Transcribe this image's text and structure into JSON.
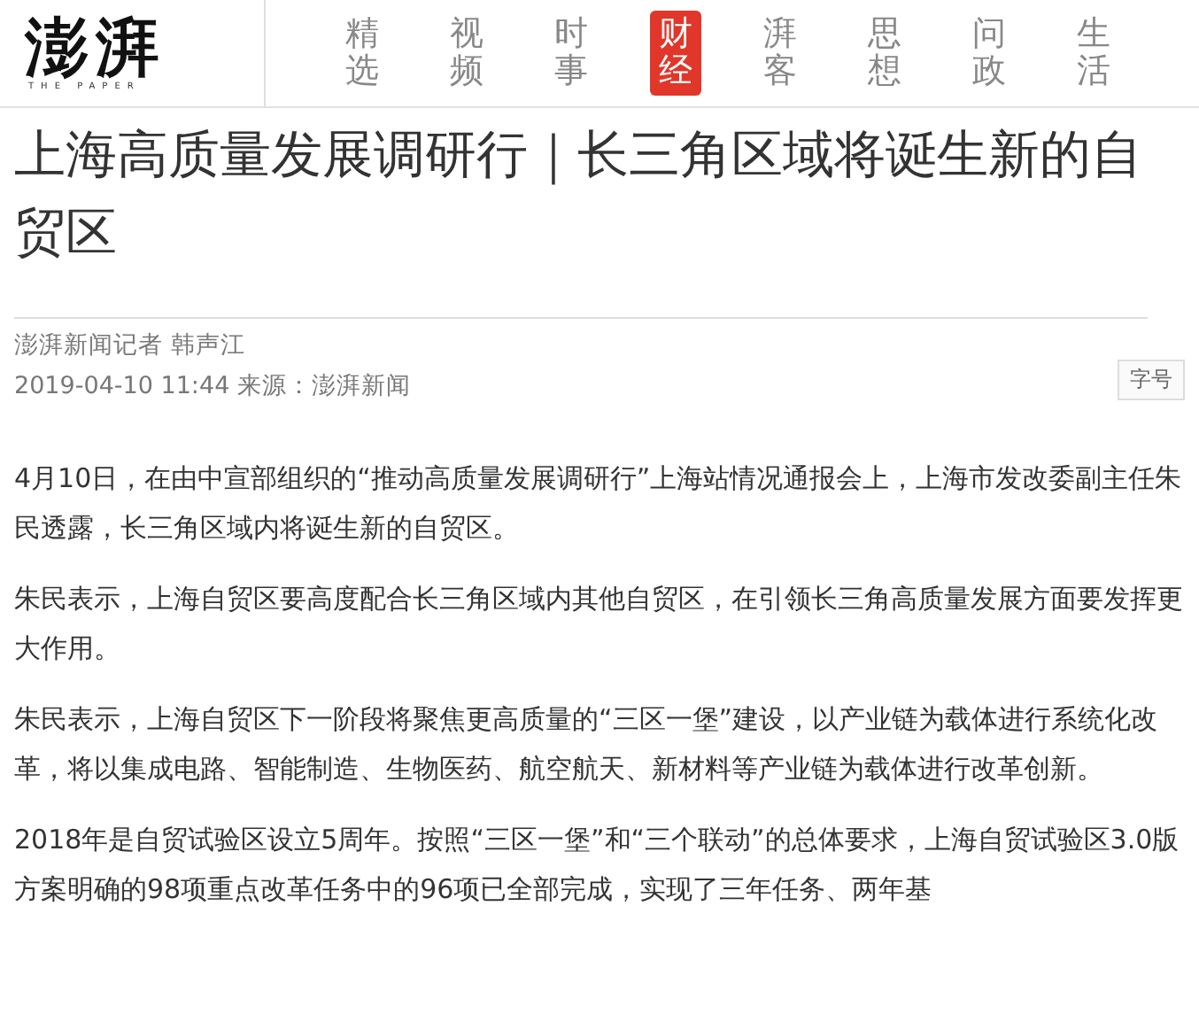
{
  "header": {
    "logo": "澎湃",
    "logo_tagline": "THE PAPER",
    "nav": [
      {
        "label": "精选",
        "selected": false
      },
      {
        "label": "视频",
        "selected": false
      },
      {
        "label": "时事",
        "selected": false
      },
      {
        "label": "财经",
        "selected": true
      },
      {
        "label": "湃客",
        "selected": false
      },
      {
        "label": "思想",
        "selected": false
      },
      {
        "label": "问政",
        "selected": false
      },
      {
        "label": "生活",
        "selected": false
      }
    ]
  },
  "article": {
    "title": "上海高质量发展调研行｜长三角区域将诞生新的自贸区",
    "author": "澎湃新闻记者 韩声江",
    "dateline": "2019-04-10 11:44 来源：澎湃新闻",
    "font_size_button": "字号",
    "paragraphs": [
      "4月10日，在由中宣部组织的“推动高质量发展调研行”上海站情况通报会上，上海市发改委副主任朱民透露，长三角区域内将诞生新的自贸区。",
      "朱民表示，上海自贸区要高度配合长三角区域内其他自贸区，在引领长三角高质量发展方面要发挥更大作用。",
      "朱民表示，上海自贸区下一阶段将聚焦更高质量的“三区一堡”建设，以产业链为载体进行系统化改革，将以集成电路、智能制造、生物医药、航空航天、新材料等产业链为载体进行改革创新。",
      "2018年是自贸试验区设立5周年。按照“三区一堡”和“三个联动”的总体要求，上海自贸试验区3.0版方案明确的98项重点改革任务中的96项已全部完成，实现了三年任务、两年基"
    ]
  }
}
